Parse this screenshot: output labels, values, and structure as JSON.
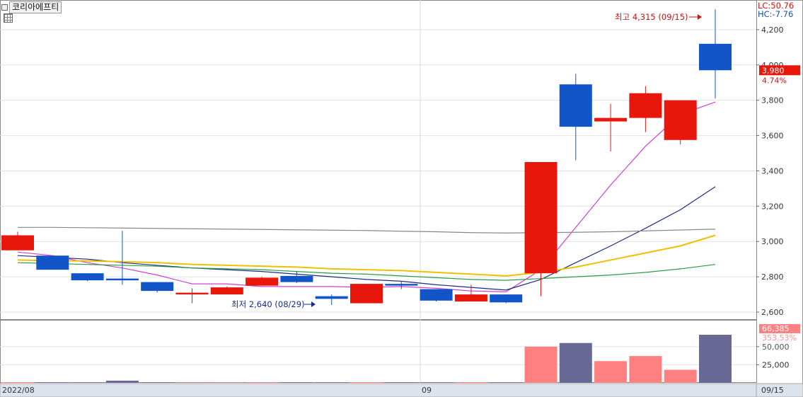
{
  "toolbar": {
    "title": "코리아에프티"
  },
  "legend": {
    "lc": "LC:50.76",
    "hc": "HC:-7.76"
  },
  "current": {
    "price": "3,980",
    "change": "4.74%"
  },
  "annotations": {
    "high": "최고 4,315 (09/15)",
    "low": "최저 2,640 (08/29)"
  },
  "xlabels": {
    "start": "2022/08",
    "month": "09",
    "end": "09/15"
  },
  "volume_labels": {
    "value": "66,385",
    "pct": "353.53%",
    "partial": "50,000",
    "tick": "25,000"
  },
  "colors": {
    "up": "#e8170c",
    "down": "#1155c8",
    "vol_up": "#ff8080",
    "vol_down": "#686895",
    "ma5": "#d040d0",
    "ma10": "#1a2a88",
    "ma20": "#f0c000",
    "ma60": "#2a9a4a",
    "ma120": "#888888"
  },
  "chart_data": [
    {
      "type": "candlestick",
      "y_ticks": [
        2600,
        2800,
        3000,
        3200,
        3400,
        3600,
        3800,
        4000,
        4200
      ],
      "ylim": [
        2560,
        4360
      ],
      "grid": true,
      "candles": [
        {
          "o": 2950,
          "h": 3055,
          "l": 2950,
          "c": 3035
        },
        {
          "o": 2920,
          "h": 2920,
          "l": 2840,
          "c": 2840
        },
        {
          "o": 2820,
          "h": 2820,
          "l": 2775,
          "c": 2780
        },
        {
          "o": 2790,
          "h": 3060,
          "l": 2755,
          "c": 2785
        },
        {
          "o": 2770,
          "h": 2770,
          "l": 2710,
          "c": 2720
        },
        {
          "o": 2700,
          "h": 2735,
          "l": 2650,
          "c": 2710
        },
        {
          "o": 2700,
          "h": 2745,
          "l": 2700,
          "c": 2740
        },
        {
          "o": 2750,
          "h": 2800,
          "l": 2750,
          "c": 2795
        },
        {
          "o": 2805,
          "h": 2830,
          "l": 2765,
          "c": 2770
        },
        {
          "o": 2690,
          "h": 2700,
          "l": 2640,
          "c": 2675
        },
        {
          "o": 2650,
          "h": 2760,
          "l": 2650,
          "c": 2760
        },
        {
          "o": 2760,
          "h": 2775,
          "l": 2730,
          "c": 2750
        },
        {
          "o": 2730,
          "h": 2730,
          "l": 2660,
          "c": 2665
        },
        {
          "o": 2660,
          "h": 2755,
          "l": 2660,
          "c": 2700
        },
        {
          "o": 2700,
          "h": 2700,
          "l": 2650,
          "c": 2655
        },
        {
          "o": 2820,
          "h": 3450,
          "l": 2690,
          "c": 3450
        },
        {
          "o": 3890,
          "h": 3950,
          "l": 3460,
          "c": 3650
        },
        {
          "o": 3680,
          "h": 3780,
          "l": 3510,
          "c": 3700
        },
        {
          "o": 3700,
          "h": 3880,
          "l": 3620,
          "c": 3840
        },
        {
          "o": 3575,
          "h": 3800,
          "l": 3550,
          "c": 3800
        },
        {
          "o": 4120,
          "h": 4315,
          "l": 3810,
          "c": 3970
        }
      ],
      "ma_lines": [
        {
          "key": "ma5",
          "values": [
            2940,
            2920,
            2880,
            2850,
            2810,
            2760,
            2760,
            2745,
            2745,
            2745,
            2740,
            2745,
            2735,
            2720,
            2715,
            2840,
            3080,
            3320,
            3540,
            3720,
            3790
          ]
        },
        {
          "key": "ma10",
          "values": [
            2920,
            2910,
            2900,
            2880,
            2865,
            2850,
            2840,
            2830,
            2815,
            2800,
            2785,
            2775,
            2755,
            2740,
            2725,
            2785,
            2880,
            2975,
            3075,
            3180,
            3310
          ]
        },
        {
          "key": "ma20",
          "values": [
            2895,
            2890,
            2890,
            2885,
            2880,
            2870,
            2865,
            2860,
            2855,
            2845,
            2840,
            2835,
            2825,
            2815,
            2805,
            2825,
            2855,
            2895,
            2935,
            2975,
            3035
          ]
        },
        {
          "key": "ma60",
          "values": [
            2880,
            2875,
            2870,
            2865,
            2860,
            2850,
            2845,
            2840,
            2830,
            2820,
            2815,
            2805,
            2795,
            2785,
            2780,
            2790,
            2800,
            2810,
            2825,
            2845,
            2870
          ]
        },
        {
          "key": "ma120",
          "values": [
            3080,
            3080,
            3078,
            3076,
            3074,
            3072,
            3070,
            3068,
            3066,
            3064,
            3062,
            3058,
            3055,
            3050,
            3048,
            3050,
            3052,
            3055,
            3060,
            3065,
            3070
          ]
        }
      ]
    },
    {
      "type": "bar",
      "title": "volume",
      "y_ticks": [
        25000,
        50000
      ],
      "ylim": [
        0,
        84000
      ],
      "values": [
        1000,
        700,
        500,
        3000,
        600,
        400,
        500,
        700,
        600,
        500,
        900,
        600,
        500,
        900,
        500,
        50000,
        55000,
        30000,
        37000,
        18000,
        66385
      ]
    }
  ]
}
